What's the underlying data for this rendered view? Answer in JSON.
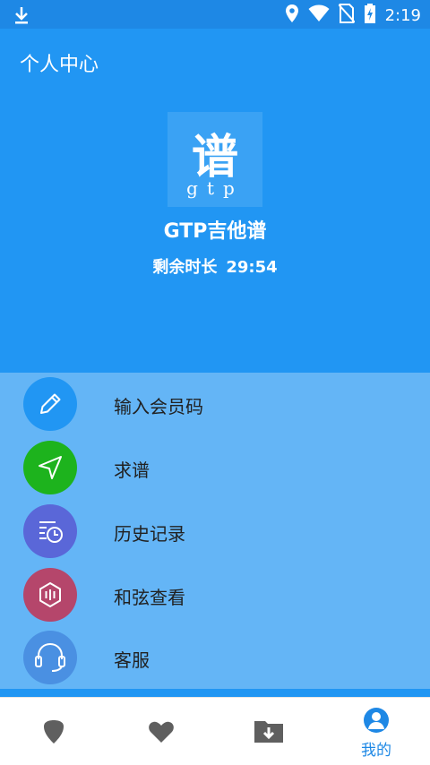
{
  "status_bar": {
    "time": "2:19",
    "icons": [
      "download-icon",
      "location-icon",
      "wifi-icon",
      "no-sim-icon",
      "battery-charging-icon"
    ]
  },
  "header": {
    "title": "个人中心",
    "app_name": "GTP吉他谱",
    "remaining_label": "剩余时长",
    "remaining_value": "29:54"
  },
  "logo": {
    "text_main": "谱",
    "text_sub": "gtp",
    "bg_color": "#3aa2f4"
  },
  "menu": {
    "items": [
      {
        "label": "输入会员码",
        "icon": "pencil-icon",
        "color": "#2196f3"
      },
      {
        "label": "求谱",
        "icon": "send-icon",
        "color": "#1db31d"
      },
      {
        "label": "历史记录",
        "icon": "history-icon",
        "color": "#5a67d8"
      },
      {
        "label": "和弦查看",
        "icon": "chord-icon",
        "color": "#b5466b"
      },
      {
        "label": "客服",
        "icon": "headset-icon",
        "color": "#4a90e2"
      }
    ]
  },
  "tabbar": {
    "tabs": [
      {
        "icon": "guitar-pick-icon",
        "label": ""
      },
      {
        "icon": "heart-icon",
        "label": ""
      },
      {
        "icon": "folder-download-icon",
        "label": ""
      },
      {
        "icon": "user-icon",
        "label": "我的",
        "active": true
      }
    ],
    "active_color": "#1e88e5",
    "inactive_color": "#5f5f5f"
  },
  "colors": {
    "primary": "#2196f3",
    "status_bar": "#1e88e5",
    "menu_bg": "#64b5f6"
  }
}
